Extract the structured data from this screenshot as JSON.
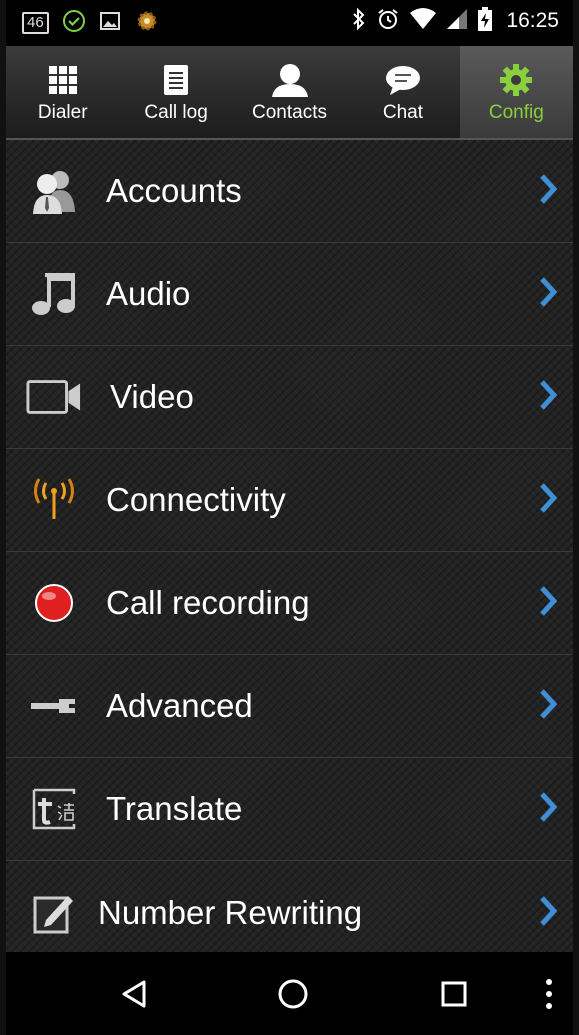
{
  "status_bar": {
    "network": "46",
    "time": "16:25",
    "icons": [
      "lte-badge-icon",
      "check-circle-icon",
      "image-icon",
      "settings-app-icon",
      "bluetooth-icon",
      "alarm-icon",
      "wifi-icon",
      "cell-signal-icon",
      "battery-charging-icon"
    ]
  },
  "tabs": [
    {
      "label": "Dialer",
      "icon": "dialpad-icon",
      "active": false
    },
    {
      "label": "Call log",
      "icon": "call-log-icon",
      "active": false
    },
    {
      "label": "Contacts",
      "icon": "contacts-icon",
      "active": false
    },
    {
      "label": "Chat",
      "icon": "chat-icon",
      "active": false
    },
    {
      "label": "Config",
      "icon": "gear-icon",
      "active": true
    }
  ],
  "config_items": [
    {
      "label": "Accounts",
      "icon": "accounts-icon"
    },
    {
      "label": "Audio",
      "icon": "music-note-icon"
    },
    {
      "label": "Video",
      "icon": "video-camera-icon"
    },
    {
      "label": "Connectivity",
      "icon": "antenna-icon"
    },
    {
      "label": "Call recording",
      "icon": "record-icon"
    },
    {
      "label": "Advanced",
      "icon": "wrench-icon"
    },
    {
      "label": "Translate",
      "icon": "translate-icon"
    },
    {
      "label": "Number Rewriting",
      "icon": "edit-note-icon"
    }
  ],
  "nav_bar": {
    "buttons": [
      "back-icon",
      "home-icon",
      "recents-icon",
      "overflow-menu-icon"
    ]
  },
  "colors": {
    "accent": "#8ccf3c",
    "chevron": "#3f8fd6",
    "record": "#e02020",
    "antenna": "#f0a020"
  }
}
